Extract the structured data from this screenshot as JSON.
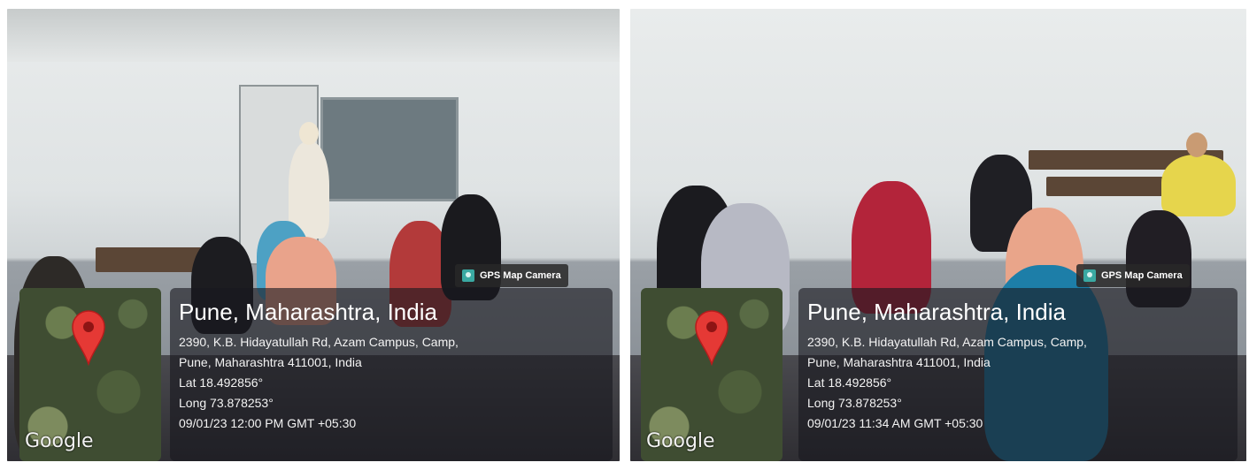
{
  "photos": [
    {
      "badge": "GPS Map Camera",
      "logo": "Google",
      "title": "Pune, Maharashtra, India",
      "address_line1": "2390, K.B. Hidayatullah Rd, Azam Campus, Camp,",
      "address_line2": "Pune, Maharashtra 411001, India",
      "lat": "Lat 18.492856°",
      "long": "Long 73.878253°",
      "datetime": "09/01/23 12:00 PM GMT +05:30"
    },
    {
      "badge": "GPS Map Camera",
      "logo": "Google",
      "title": "Pune, Maharashtra, India",
      "address_line1": "2390, K.B. Hidayatullah Rd, Azam Campus, Camp,",
      "address_line2": "Pune, Maharashtra 411001, India",
      "lat": "Lat 18.492856°",
      "long": "Long 73.878253°",
      "datetime": "09/01/23 11:34 AM GMT +05:30"
    }
  ],
  "colors": {
    "pin": "#e53935",
    "badge_icon": "#3aa9a2"
  }
}
